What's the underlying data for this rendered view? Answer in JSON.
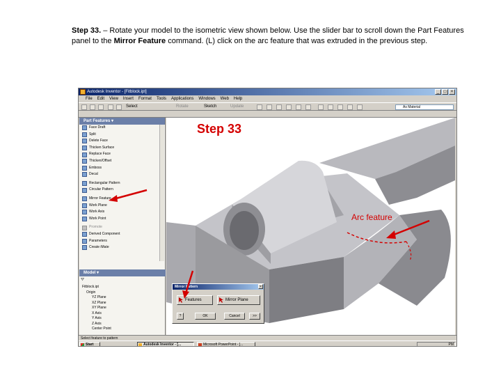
{
  "instructions": {
    "step_prefix": "Step 33.",
    "text_part1": " – Rotate your model to the isometric view shown below. Use the slider bar to scroll down the Part Features panel to the ",
    "command": "Mirror Feature",
    "text_part2": " command. (L) click on the arc feature that was extruded in the previous step."
  },
  "window": {
    "title": "Autodesk Inventor - [Fitblock.ipt]",
    "controls": [
      "_",
      "□",
      "×"
    ]
  },
  "menu": [
    "File",
    "Edit",
    "View",
    "Insert",
    "Format",
    "Tools",
    "Applications",
    "Windows",
    "Web",
    "Help"
  ],
  "toolbar": {
    "select_label": "Select",
    "rotate_label": "Rotate",
    "sketch_label": "Sketch",
    "update_label": "Update",
    "material": "As Material"
  },
  "part_features": {
    "header": "Part Features",
    "items": [
      {
        "label": "Face Draft",
        "enabled": true
      },
      {
        "label": "Split",
        "enabled": true
      },
      {
        "label": "Delete Face",
        "enabled": true
      },
      {
        "label": "Thicken Surface",
        "enabled": true
      },
      {
        "label": "Replace Face",
        "enabled": true
      },
      {
        "label": "Thicken/Offset",
        "enabled": true
      },
      {
        "label": "Emboss",
        "enabled": true
      },
      {
        "label": "Decal",
        "enabled": true
      },
      {
        "label": "Rectangular Pattern",
        "enabled": true
      },
      {
        "label": "Circular Pattern",
        "enabled": true
      },
      {
        "label": "Mirror Feature",
        "enabled": true
      },
      {
        "label": "Work Plane",
        "enabled": true
      },
      {
        "label": "Work Axis",
        "enabled": true
      },
      {
        "label": "Work Point",
        "enabled": true
      },
      {
        "label": "Promote",
        "enabled": false
      },
      {
        "label": "Derived Component",
        "enabled": true
      },
      {
        "label": "Parameters",
        "enabled": true
      },
      {
        "label": "Create iMate",
        "enabled": true
      }
    ]
  },
  "model": {
    "header": "Model",
    "tree": [
      "Fitblock.ipt",
      "Origin",
      "YZ Plane",
      "XZ Plane",
      "XY Plane",
      "X Axis",
      "Y Axis",
      "Z Axis",
      "Center Point"
    ]
  },
  "annotations": {
    "step_label": "Step 33",
    "arc_label": "Arc feature"
  },
  "dialog": {
    "title": "Mirror Pattern",
    "features_label": "Features",
    "mirror_plane_label": "Mirror Plane",
    "ok_label": "OK",
    "cancel_label": "Cancel",
    "more_label": ">>",
    "help_label": "?"
  },
  "status": "Select feature to pattern",
  "taskbar": {
    "start": "Start",
    "items": [
      "Autodesk Inventor - [...",
      "Microsoft PowerPoint - [..."
    ],
    "clock": "PM"
  },
  "colors": {
    "annotation_red": "#d40000",
    "model_grey": "#9a9a9e",
    "panel_header": "#6b7fa8",
    "titlebar": "#0a246a"
  }
}
